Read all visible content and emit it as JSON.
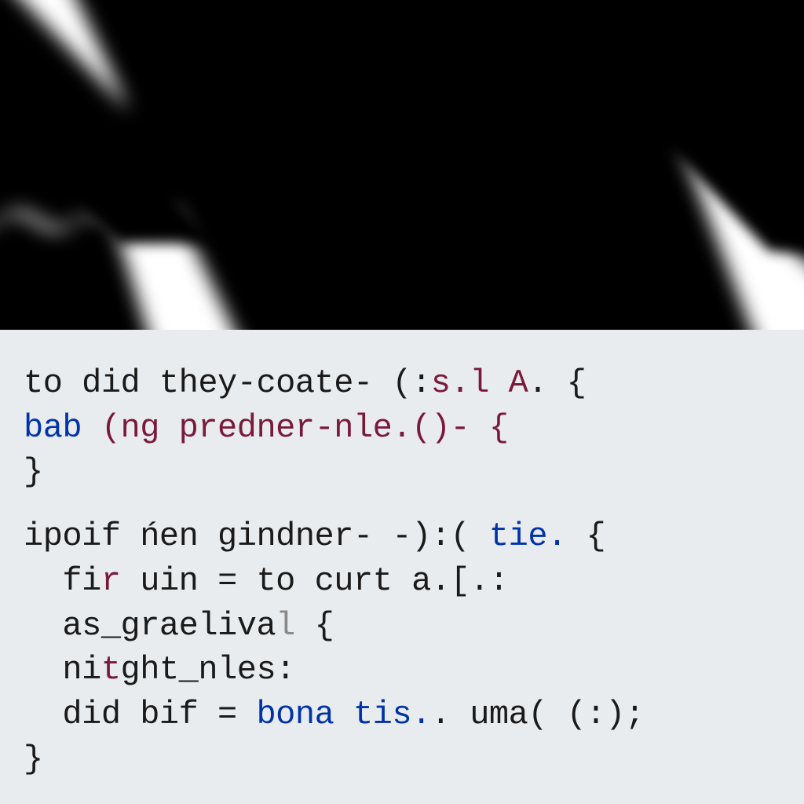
{
  "code": {
    "line1": {
      "p1": "to did they-coate- (:",
      "p2": "s.l",
      "p3": " A",
      "p4": ". {"
    },
    "line2": {
      "p1": "bab",
      "p2": " (ng predner-nle.()- {"
    },
    "line3": {
      "p1": "}"
    },
    "line4": {
      "p1": "ipoif ńen gindner- -):( ",
      "p2": "tie.",
      "p3": " {"
    },
    "line5": {
      "p1": "  fi",
      "p2": "r",
      "p3": " uin = to curt a.[.:"
    },
    "line6": {
      "p1": "  as_graeliva",
      "p2": "l",
      "p3": " {"
    },
    "line7": {
      "p1": "  ni",
      "p2": "t",
      "p3": "ght_nles:"
    },
    "line8": {
      "p1": "  did bif = ",
      "p2": "bona tis.",
      "p3": ". uma( (:);"
    },
    "line9": {
      "p1": "}"
    }
  }
}
